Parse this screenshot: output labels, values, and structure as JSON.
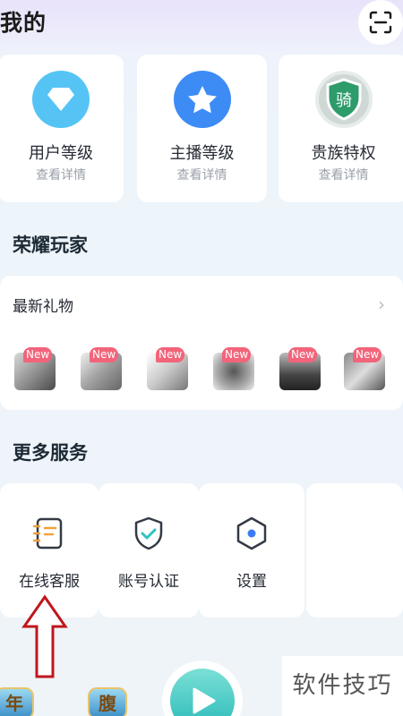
{
  "header": {
    "title": "我的"
  },
  "levels": [
    {
      "label": "用户等级",
      "sub": "查看详情",
      "icon": "diamond-icon",
      "color": "#4fc3f7"
    },
    {
      "label": "主播等级",
      "sub": "查看详情",
      "icon": "star-icon",
      "color": "#3d8bf5"
    },
    {
      "label": "贵族特权",
      "sub": "查看详情",
      "icon": "knight-shield-icon",
      "color": "#2e9b6a",
      "badge_text": "骑"
    }
  ],
  "honor": {
    "title": "荣耀玩家"
  },
  "gifts": {
    "title": "最新礼物",
    "new_tag": "New",
    "items": [
      "gift-1",
      "gift-2",
      "gift-3",
      "gift-4",
      "gift-5",
      "gift-6"
    ]
  },
  "services": {
    "title": "更多服务",
    "items": [
      {
        "label": "在线客服",
        "icon": "notebook-icon"
      },
      {
        "label": "账号认证",
        "icon": "shield-check-icon"
      },
      {
        "label": "设置",
        "icon": "hexagon-settings-icon"
      }
    ]
  },
  "bottom_nav": {
    "left_badge": "年",
    "mid_badge": "腹"
  },
  "watermark": "软件技巧",
  "colors": {
    "accent": "#2ec4c0",
    "arrow": "#c0171c",
    "new_tag": "#f2647a"
  }
}
